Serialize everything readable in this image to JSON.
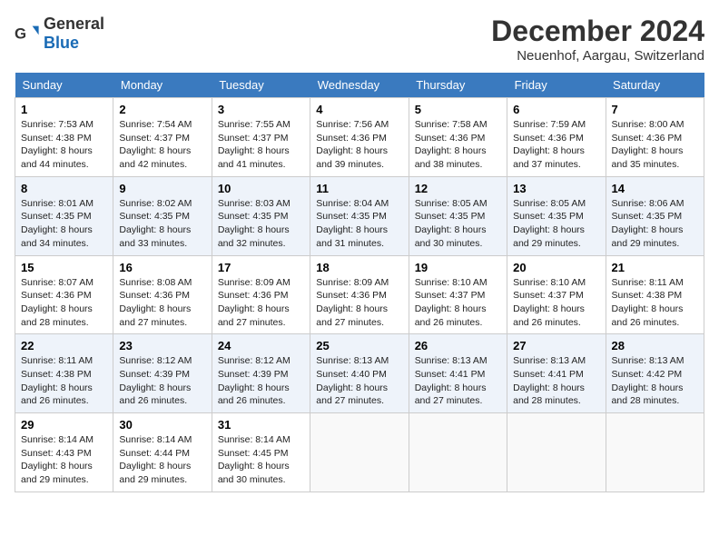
{
  "logo": {
    "general": "General",
    "blue": "Blue"
  },
  "title": "December 2024",
  "location": "Neuenhof, Aargau, Switzerland",
  "days_of_week": [
    "Sunday",
    "Monday",
    "Tuesday",
    "Wednesday",
    "Thursday",
    "Friday",
    "Saturday"
  ],
  "weeks": [
    [
      {
        "day": 1,
        "sunrise": "7:53 AM",
        "sunset": "4:38 PM",
        "daylight": "8 hours and 44 minutes."
      },
      {
        "day": 2,
        "sunrise": "7:54 AM",
        "sunset": "4:37 PM",
        "daylight": "8 hours and 42 minutes."
      },
      {
        "day": 3,
        "sunrise": "7:55 AM",
        "sunset": "4:37 PM",
        "daylight": "8 hours and 41 minutes."
      },
      {
        "day": 4,
        "sunrise": "7:56 AM",
        "sunset": "4:36 PM",
        "daylight": "8 hours and 39 minutes."
      },
      {
        "day": 5,
        "sunrise": "7:58 AM",
        "sunset": "4:36 PM",
        "daylight": "8 hours and 38 minutes."
      },
      {
        "day": 6,
        "sunrise": "7:59 AM",
        "sunset": "4:36 PM",
        "daylight": "8 hours and 37 minutes."
      },
      {
        "day": 7,
        "sunrise": "8:00 AM",
        "sunset": "4:36 PM",
        "daylight": "8 hours and 35 minutes."
      }
    ],
    [
      {
        "day": 8,
        "sunrise": "8:01 AM",
        "sunset": "4:35 PM",
        "daylight": "8 hours and 34 minutes."
      },
      {
        "day": 9,
        "sunrise": "8:02 AM",
        "sunset": "4:35 PM",
        "daylight": "8 hours and 33 minutes."
      },
      {
        "day": 10,
        "sunrise": "8:03 AM",
        "sunset": "4:35 PM",
        "daylight": "8 hours and 32 minutes."
      },
      {
        "day": 11,
        "sunrise": "8:04 AM",
        "sunset": "4:35 PM",
        "daylight": "8 hours and 31 minutes."
      },
      {
        "day": 12,
        "sunrise": "8:05 AM",
        "sunset": "4:35 PM",
        "daylight": "8 hours and 30 minutes."
      },
      {
        "day": 13,
        "sunrise": "8:05 AM",
        "sunset": "4:35 PM",
        "daylight": "8 hours and 29 minutes."
      },
      {
        "day": 14,
        "sunrise": "8:06 AM",
        "sunset": "4:35 PM",
        "daylight": "8 hours and 29 minutes."
      }
    ],
    [
      {
        "day": 15,
        "sunrise": "8:07 AM",
        "sunset": "4:36 PM",
        "daylight": "8 hours and 28 minutes."
      },
      {
        "day": 16,
        "sunrise": "8:08 AM",
        "sunset": "4:36 PM",
        "daylight": "8 hours and 27 minutes."
      },
      {
        "day": 17,
        "sunrise": "8:09 AM",
        "sunset": "4:36 PM",
        "daylight": "8 hours and 27 minutes."
      },
      {
        "day": 18,
        "sunrise": "8:09 AM",
        "sunset": "4:36 PM",
        "daylight": "8 hours and 27 minutes."
      },
      {
        "day": 19,
        "sunrise": "8:10 AM",
        "sunset": "4:37 PM",
        "daylight": "8 hours and 26 minutes."
      },
      {
        "day": 20,
        "sunrise": "8:10 AM",
        "sunset": "4:37 PM",
        "daylight": "8 hours and 26 minutes."
      },
      {
        "day": 21,
        "sunrise": "8:11 AM",
        "sunset": "4:38 PM",
        "daylight": "8 hours and 26 minutes."
      }
    ],
    [
      {
        "day": 22,
        "sunrise": "8:11 AM",
        "sunset": "4:38 PM",
        "daylight": "8 hours and 26 minutes."
      },
      {
        "day": 23,
        "sunrise": "8:12 AM",
        "sunset": "4:39 PM",
        "daylight": "8 hours and 26 minutes."
      },
      {
        "day": 24,
        "sunrise": "8:12 AM",
        "sunset": "4:39 PM",
        "daylight": "8 hours and 26 minutes."
      },
      {
        "day": 25,
        "sunrise": "8:13 AM",
        "sunset": "4:40 PM",
        "daylight": "8 hours and 27 minutes."
      },
      {
        "day": 26,
        "sunrise": "8:13 AM",
        "sunset": "4:41 PM",
        "daylight": "8 hours and 27 minutes."
      },
      {
        "day": 27,
        "sunrise": "8:13 AM",
        "sunset": "4:41 PM",
        "daylight": "8 hours and 28 minutes."
      },
      {
        "day": 28,
        "sunrise": "8:13 AM",
        "sunset": "4:42 PM",
        "daylight": "8 hours and 28 minutes."
      }
    ],
    [
      {
        "day": 29,
        "sunrise": "8:14 AM",
        "sunset": "4:43 PM",
        "daylight": "8 hours and 29 minutes."
      },
      {
        "day": 30,
        "sunrise": "8:14 AM",
        "sunset": "4:44 PM",
        "daylight": "8 hours and 29 minutes."
      },
      {
        "day": 31,
        "sunrise": "8:14 AM",
        "sunset": "4:45 PM",
        "daylight": "8 hours and 30 minutes."
      },
      null,
      null,
      null,
      null
    ]
  ]
}
